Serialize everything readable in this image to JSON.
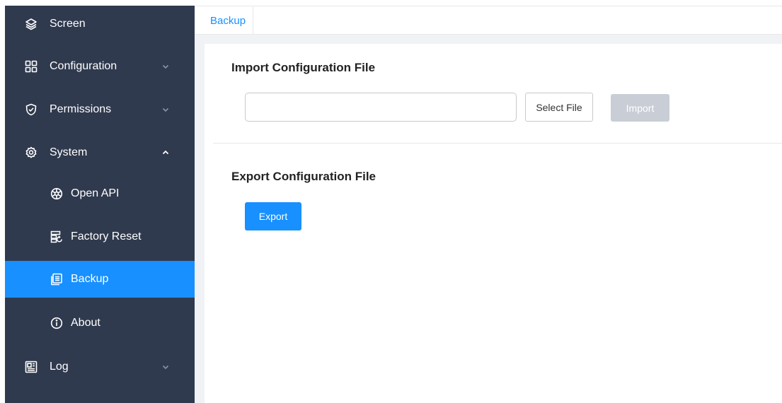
{
  "sidebar": {
    "items": [
      {
        "key": "screen",
        "label": "Screen",
        "icon": "layers-icon",
        "chevron": null
      },
      {
        "key": "configuration",
        "label": "Configuration",
        "icon": "grid-icon",
        "chevron": "down"
      },
      {
        "key": "permissions",
        "label": "Permissions",
        "icon": "shield-icon",
        "chevron": "down"
      },
      {
        "key": "system",
        "label": "System",
        "icon": "gear-icon",
        "chevron": "up"
      },
      {
        "key": "open-api",
        "label": "Open API",
        "icon": "aperture-icon",
        "chevron": null,
        "sub": true
      },
      {
        "key": "factory-reset",
        "label": "Factory Reset",
        "icon": "reset-icon",
        "chevron": null,
        "sub": true
      },
      {
        "key": "backup",
        "label": "Backup",
        "icon": "copy-icon",
        "chevron": null,
        "sub": true,
        "active": true
      },
      {
        "key": "about",
        "label": "About",
        "icon": "info-icon",
        "chevron": null,
        "sub": true
      },
      {
        "key": "log",
        "label": "Log",
        "icon": "log-icon",
        "chevron": "down"
      }
    ]
  },
  "tabs": {
    "active_label": "Backup"
  },
  "import_section": {
    "title": "Import Configuration File",
    "file_input_value": "",
    "select_file_label": "Select File",
    "import_label": "Import"
  },
  "export_section": {
    "title": "Export Configuration File",
    "export_label": "Export"
  },
  "colors": {
    "sidebar_bg": "#303a4e",
    "accent": "#1890ff",
    "disabled_button": "#c9ced6",
    "content_bg": "#f0f2f5"
  }
}
